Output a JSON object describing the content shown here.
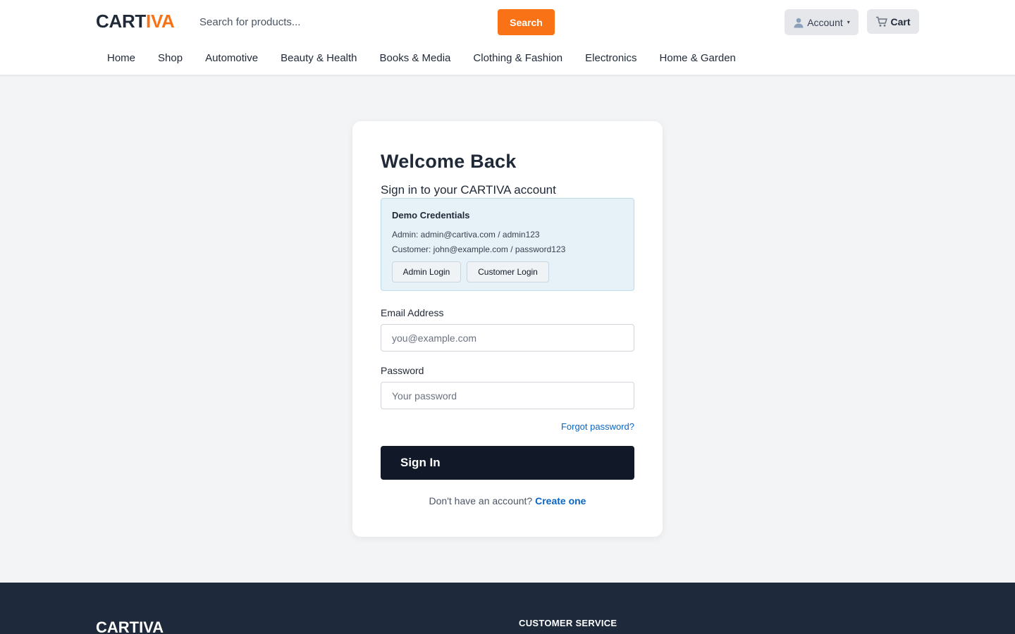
{
  "header": {
    "logo_part1": "CART",
    "logo_part2": "IVA",
    "search_placeholder": "Search for products...",
    "search_button": "Search",
    "account_label": "Account",
    "account_caret": "▾",
    "cart_label": "Cart",
    "icons": {
      "account": "user-icon",
      "cart": "cart-icon"
    }
  },
  "nav": {
    "items": [
      "Home",
      "Shop",
      "Automotive",
      "Beauty & Health",
      "Books & Media",
      "Clothing & Fashion",
      "Electronics",
      "Home & Garden"
    ]
  },
  "login": {
    "title": "Welcome Back",
    "subtitle": "Sign in to your CARTIVA account",
    "demo": {
      "title": "Demo Credentials",
      "admin_line": "Admin: admin@cartiva.com / admin123",
      "customer_line": "Customer: john@example.com / password123",
      "admin_button": "Admin Login",
      "customer_button": "Customer Login"
    },
    "email_label": "Email Address",
    "email_placeholder": "you@example.com",
    "password_label": "Password",
    "password_placeholder": "Your password",
    "forgot_link": "Forgot password?",
    "submit": "Sign In",
    "signup_prompt": "Don't have an account?",
    "signup_link": "Create one"
  },
  "footer": {
    "logo": "CARTIVA",
    "column_heading": "CUSTOMER SERVICE"
  },
  "colors": {
    "accent": "#f97316",
    "primary_button": "#111827",
    "link": "#0a66c2",
    "footer_bg": "#1e293b",
    "demo_box_bg": "#e7f2f8"
  }
}
